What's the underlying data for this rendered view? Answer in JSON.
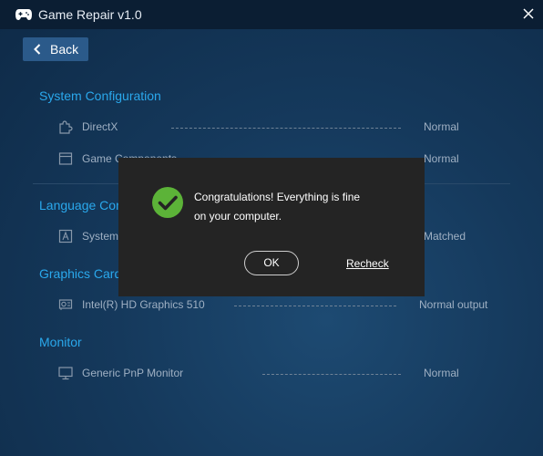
{
  "app": {
    "title": "Game Repair v1.0",
    "icon": "gamepad-icon",
    "close_icon": "close-icon"
  },
  "nav": {
    "back_label": "Back"
  },
  "sections": [
    {
      "title": "System Configuration",
      "rows": [
        {
          "name": "DirectX",
          "status": "Normal",
          "icon": "puzzle-icon"
        },
        {
          "name": "Game Components",
          "status": "Normal",
          "icon": "window-icon"
        }
      ]
    },
    {
      "title": "Language Configuration",
      "rows": [
        {
          "name": "System Language",
          "status": "Matched",
          "icon": "letter-a-icon"
        }
      ]
    },
    {
      "title": "Graphics Card",
      "rows": [
        {
          "name": "Intel(R) HD Graphics 510",
          "status": "Normal output",
          "icon": "graphics-card-icon"
        }
      ]
    },
    {
      "title": "Monitor",
      "rows": [
        {
          "name": "Generic PnP Monitor",
          "status": "Normal",
          "icon": "monitor-icon"
        }
      ]
    }
  ],
  "dialog": {
    "message_line1": "Congratulations! Everything is fine",
    "message_line2": "on your computer.",
    "ok_label": "OK",
    "recheck_label": "Recheck",
    "icon": "check-circle-icon",
    "accent_color": "#5cb338"
  },
  "colors": {
    "section_title": "#2aa8ec",
    "titlebar": "#0b1e33",
    "back_button": "#2b5a8a"
  }
}
